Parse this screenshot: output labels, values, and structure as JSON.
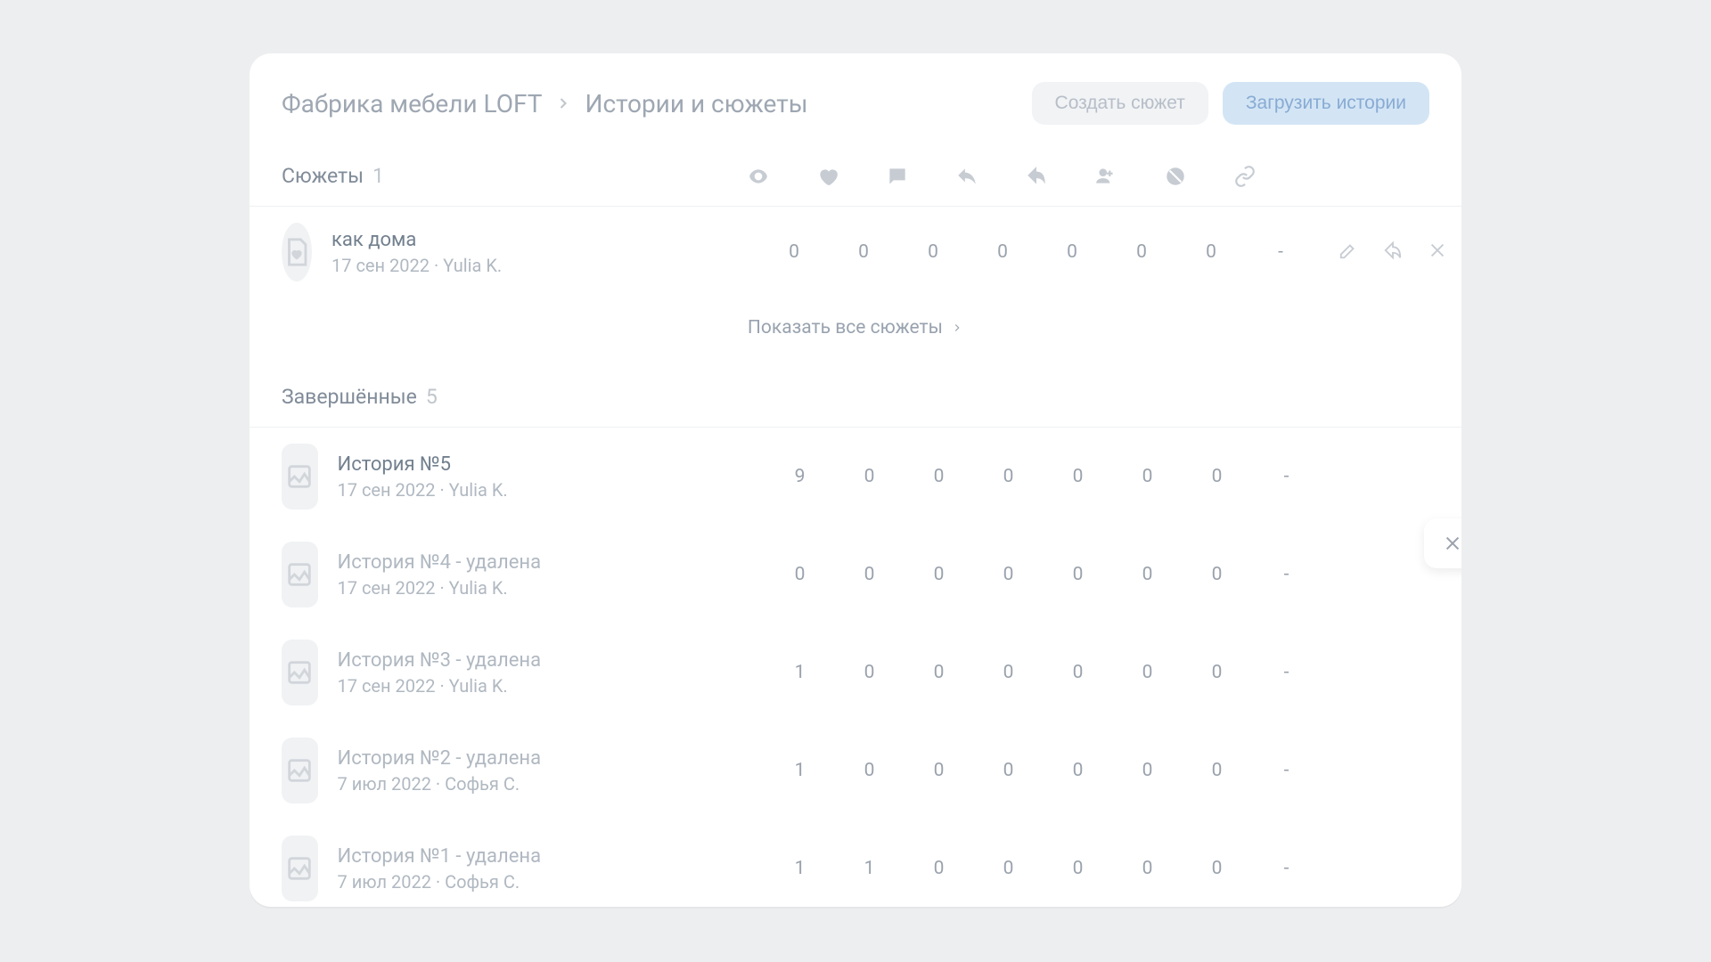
{
  "breadcrumb": {
    "root": "Фабрика мебели LOFT",
    "current": "Истории и сюжеты"
  },
  "actions": {
    "create_plot": "Создать сюжет",
    "upload_stories": "Загрузить истории"
  },
  "sections": {
    "plots": {
      "title": "Сюжеты",
      "count": "1"
    },
    "finished": {
      "title": "Завершённые",
      "count": "5"
    }
  },
  "show_all": "Показать все сюжеты",
  "plot_rows": [
    {
      "title": "как дома",
      "date": "17 сен 2022",
      "author": "Yulia K.",
      "stats": [
        "0",
        "0",
        "0",
        "0",
        "0",
        "0",
        "0",
        "-"
      ]
    }
  ],
  "finished_rows": [
    {
      "title": "История №5",
      "deleted": false,
      "date": "17 сен 2022",
      "author": "Yulia K.",
      "stats": [
        "9",
        "0",
        "0",
        "0",
        "0",
        "0",
        "0",
        "-"
      ]
    },
    {
      "title": "История №4 - удалена",
      "deleted": true,
      "date": "17 сен 2022",
      "author": "Yulia K.",
      "stats": [
        "0",
        "0",
        "0",
        "0",
        "0",
        "0",
        "0",
        "-"
      ]
    },
    {
      "title": "История №3 - удалена",
      "deleted": true,
      "date": "17 сен 2022",
      "author": "Yulia K.",
      "stats": [
        "1",
        "0",
        "0",
        "0",
        "0",
        "0",
        "0",
        "-"
      ]
    },
    {
      "title": "История №2 - удалена",
      "deleted": true,
      "date": "7 июл 2022",
      "author": "Софья С.",
      "stats": [
        "1",
        "0",
        "0",
        "0",
        "0",
        "0",
        "0",
        "-"
      ]
    },
    {
      "title": "История №1 - удалена",
      "deleted": true,
      "date": "7 июл 2022",
      "author": "Софья С.",
      "stats": [
        "1",
        "1",
        "0",
        "0",
        "0",
        "0",
        "0",
        "-"
      ]
    }
  ]
}
